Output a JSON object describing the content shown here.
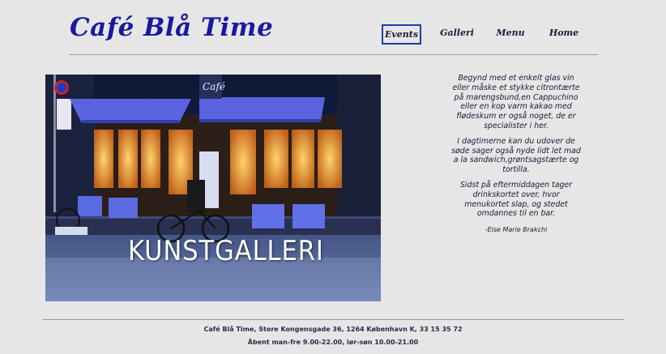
{
  "header": {
    "logo": "Café Blå Time"
  },
  "nav": {
    "items": [
      {
        "label": "Events",
        "active": true
      },
      {
        "label": "Galleri",
        "active": false
      },
      {
        "label": "Menu",
        "active": false
      },
      {
        "label": "Home",
        "active": false
      }
    ]
  },
  "hero": {
    "label": "KUNSTGALLERI",
    "sign": "Café"
  },
  "intro": {
    "paragraph_1": "Begynd med et enkelt glas vin eller måske et stykke citrontærte på marengsbund,en Cappuchino eller en kop varm kakao med flødeskum er også noget, de er specialister i her.",
    "paragraph_2": "I dagtimerne kan du udover de søde sager også nyde lidt let mad a la sandwich,grøntsagstærte og tortilla.",
    "paragraph_3": "Sidst på eftermiddagen tager drinkskortet over, hvor menukortet slap, og stedet omdannes til en bar.",
    "signature": "-Else Marie Brakchi"
  },
  "footer": {
    "address": "Café Blå Time, Store Kongensgade 36, 1264 København K, 33 15 35 72",
    "hours": "Åbent man-fre 9.00-22.00, lør-søn 10.00-21.00"
  },
  "colors": {
    "background": "#e6e6e6",
    "brand": "#1a1a9e",
    "active_border": "#1d3ea3"
  }
}
